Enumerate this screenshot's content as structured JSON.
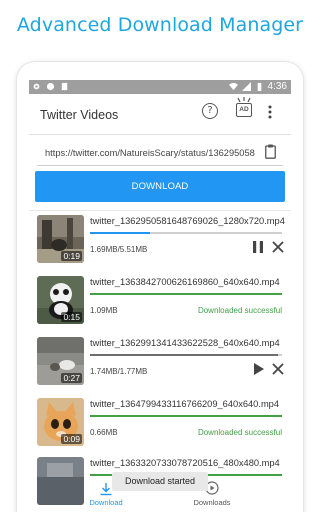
{
  "promo": {
    "title": "Advanced Download Manager"
  },
  "statusbar": {
    "time": "4:36"
  },
  "appbar": {
    "title": "Twitter Videos",
    "ad_label": "AD"
  },
  "url_input": {
    "value": "https://twitter.com/NatureisScary/status/136295058"
  },
  "download_button": {
    "label": "DOWNLOAD"
  },
  "items": [
    {
      "filename": "twitter_1362950581648769026_1280x720.mp4",
      "duration": "0:19",
      "size": "1.69MB/5.51MB",
      "progress": 0.31,
      "state": "downloading",
      "status": ""
    },
    {
      "filename": "twitter_1363842700626169860_640x640.mp4",
      "duration": "0:15",
      "size": "1.09MB",
      "progress": 1.0,
      "state": "completed",
      "status": "Downloaded successful"
    },
    {
      "filename": "twitter_1362991341433622528_640x640.mp4",
      "duration": "0:27",
      "size": "1.74MB/1.77MB",
      "progress": 0.98,
      "state": "paused",
      "status": ""
    },
    {
      "filename": "twitter_1364799433116766209_640x640.mp4",
      "duration": "0:09",
      "size": "0.66MB",
      "progress": 1.0,
      "state": "completed",
      "status": "Downloaded successful"
    },
    {
      "filename": "twitter_1363320733078720516_480x480.mp4",
      "duration": "",
      "size": "",
      "progress": 1.0,
      "state": "completed",
      "status": ""
    }
  ],
  "snackbar": {
    "text": "Download started"
  },
  "bottom_nav": {
    "download_label": "Download",
    "downloads_label": "Downloads"
  },
  "colors": {
    "accent": "#2196f3",
    "promo": "#1fa6e0",
    "success": "#43a047",
    "track": "#d0d0d0"
  }
}
